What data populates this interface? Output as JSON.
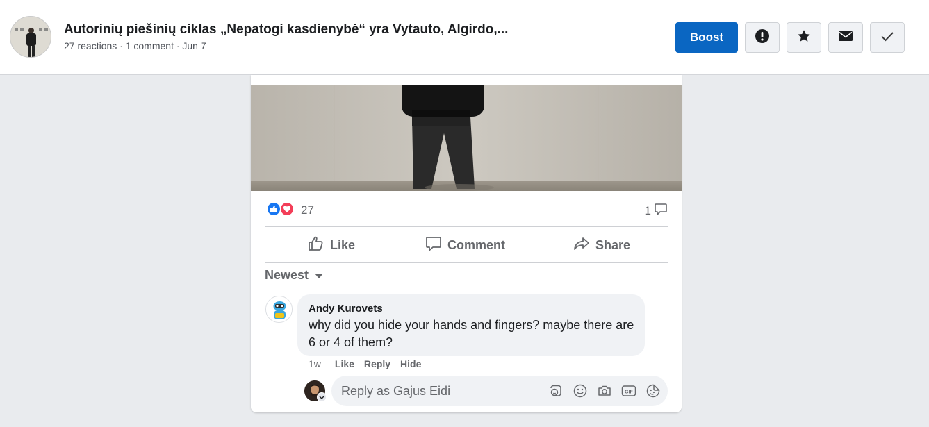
{
  "header": {
    "title": "Autorinių piešinių ciklas „Nepatogi kasdienybė“ yra Vytauto, Algirdo,...",
    "meta": "27 reactions · 1 comment · Jun 7",
    "boost_label": "Boost",
    "icons": [
      "alert-icon",
      "star-icon",
      "mail-icon",
      "check-icon"
    ]
  },
  "post": {
    "reaction_count": "27",
    "comment_count": "1",
    "actions": {
      "like": "Like",
      "comment": "Comment",
      "share": "Share"
    },
    "sort_label": "Newest"
  },
  "comment": {
    "author": "Andy Kurovets",
    "text": "why did you hide your hands and fingers? maybe there are 6 or 4 of them?",
    "time": "1w",
    "like": "Like",
    "reply": "Reply",
    "hide": "Hide"
  },
  "reply_box": {
    "placeholder": "Reply as Gajus Eidi",
    "icons": [
      "avatar-sticker-icon",
      "emoji-icon",
      "camera-icon",
      "gif-icon",
      "sticker-icon"
    ]
  },
  "colors": {
    "accent": "#0a66c2",
    "like_blue": "#1877f2",
    "love_red": "#f33e58",
    "background": "#e9ebee"
  }
}
